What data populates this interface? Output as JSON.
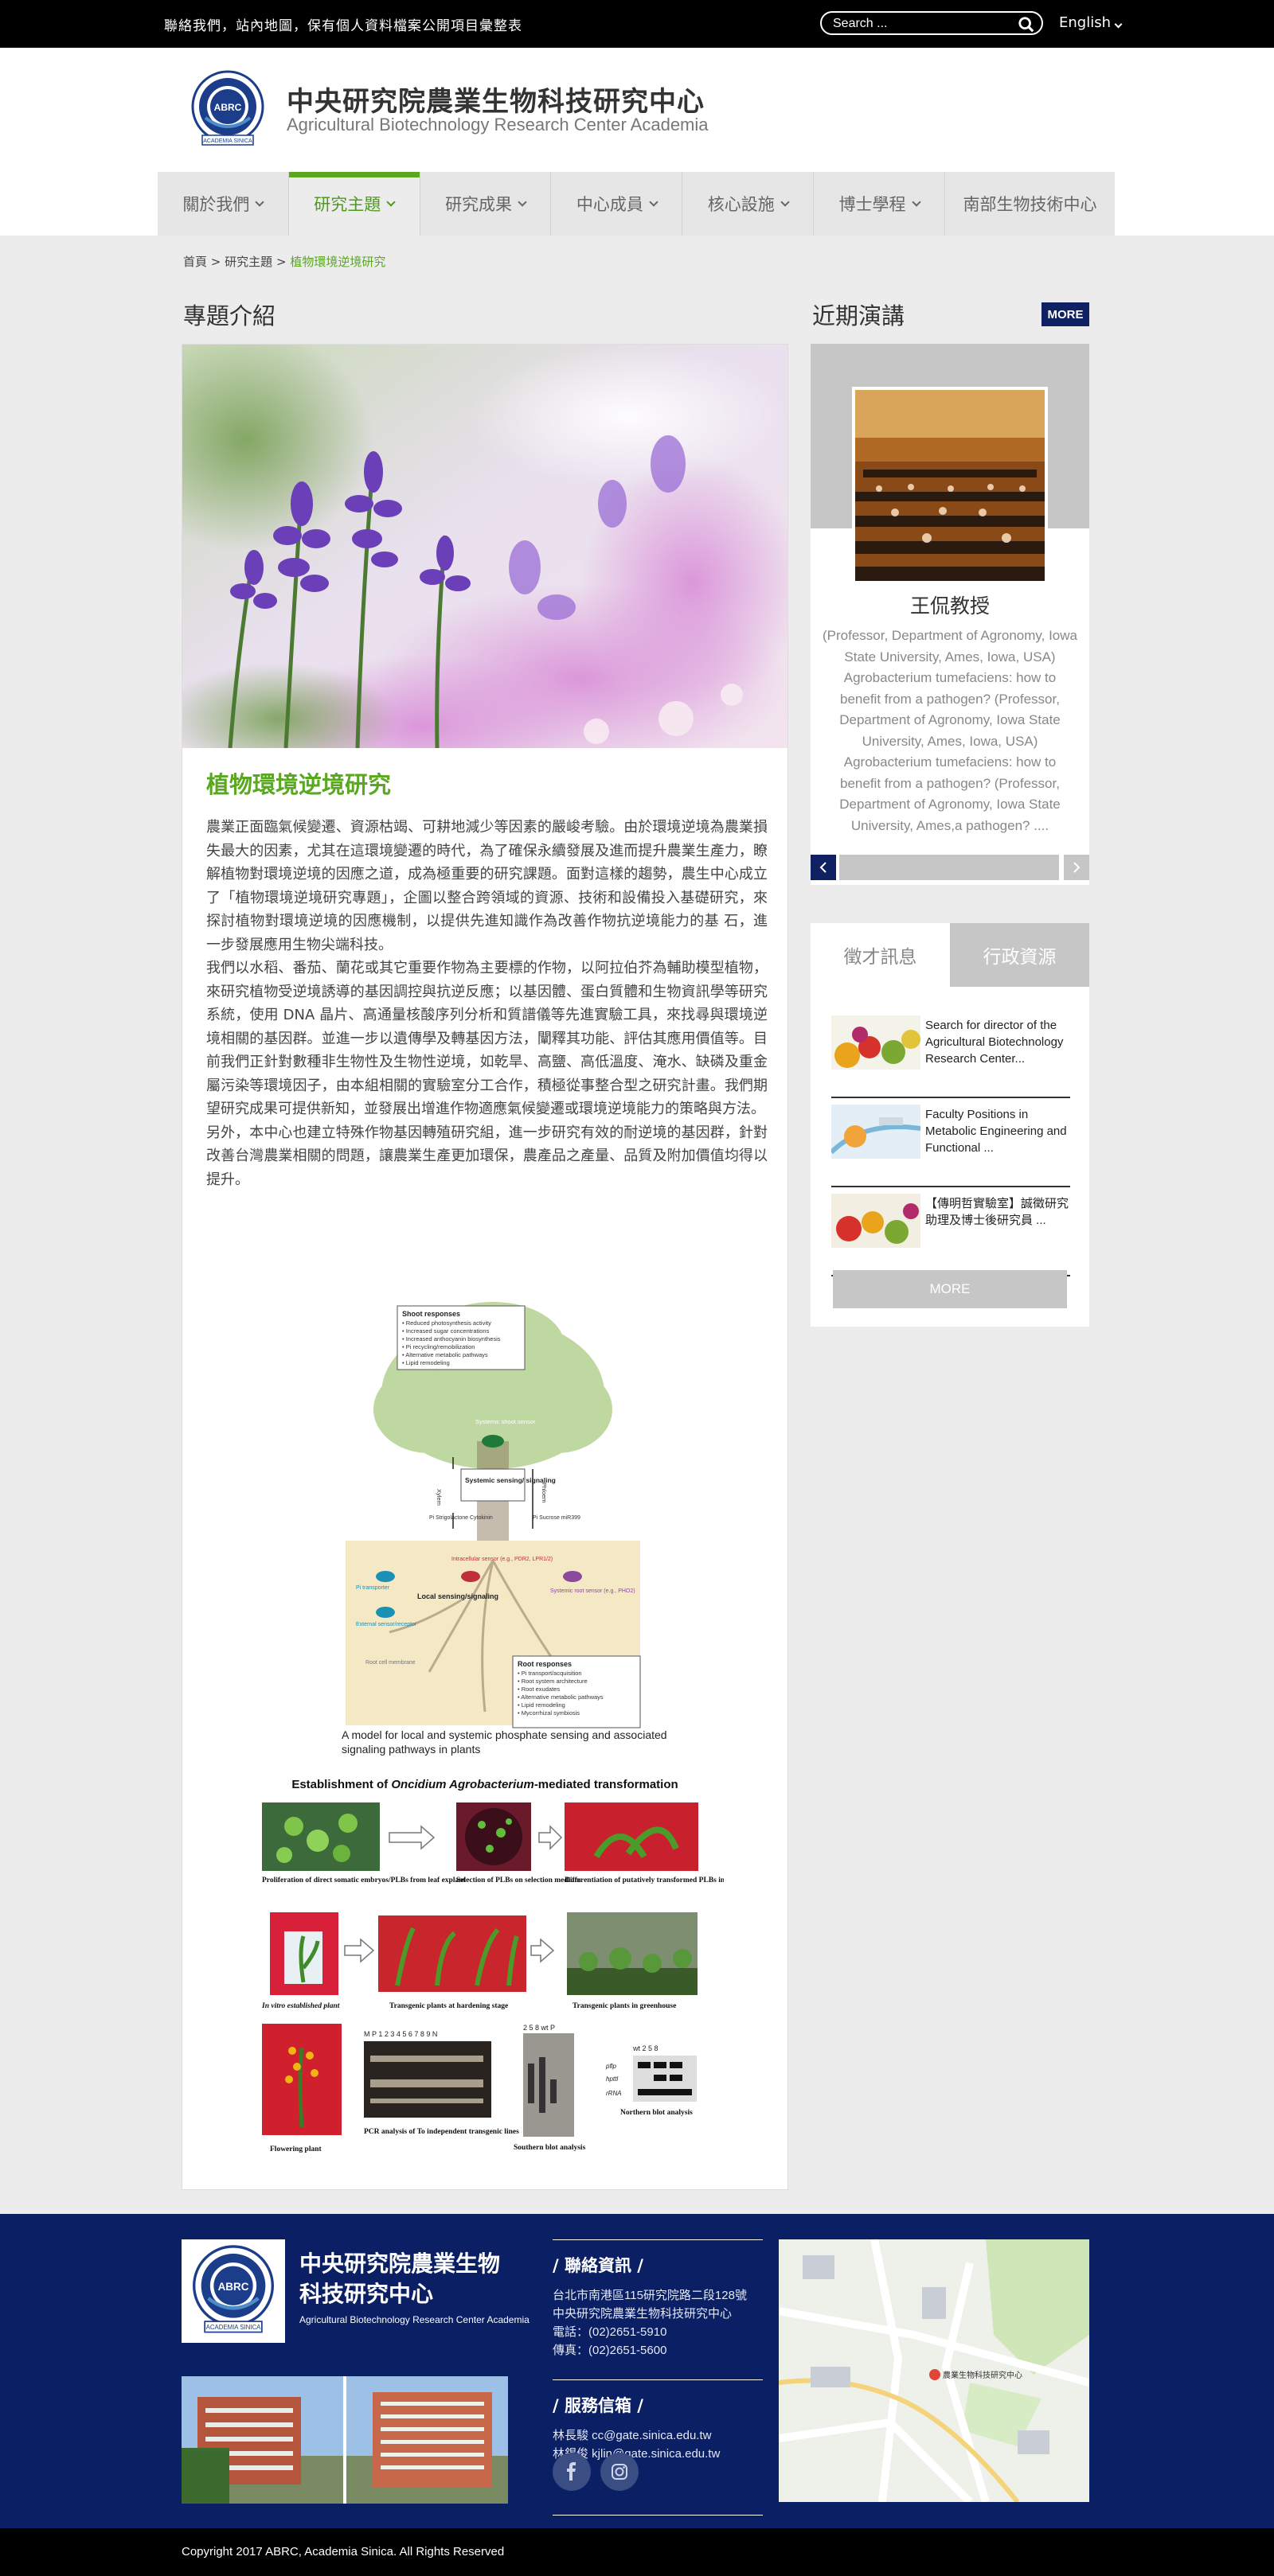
{
  "topbar": {
    "links": "聯絡我們，站內地圖，保有個人資料檔案公開項目彙整表",
    "search_placeholder": "Search ...",
    "language": "English"
  },
  "header": {
    "title": "中央研究院農業生物科技研究中心",
    "subtitle": "Agricultural Biotechnology Research Center Academia",
    "logo_text": "ABRC",
    "logo_caption": "ACADEMIA SINICA"
  },
  "nav": {
    "items": [
      {
        "label": "關於我們"
      },
      {
        "label": "研究主題"
      },
      {
        "label": "研究成果"
      },
      {
        "label": "中心成員"
      },
      {
        "label": "核心設施"
      },
      {
        "label": "博士學程"
      },
      {
        "label": "南部生物技術中心"
      }
    ]
  },
  "breadcrumb": {
    "home": "首頁",
    "sep": ">",
    "parent": "研究主題",
    "current": "植物環境逆境研究"
  },
  "main": {
    "section_title": "專題介紹",
    "topic_title": "植物環境逆境研究",
    "paragraphs": [
      "農業正面臨氣候變遷、資源枯竭、可耕地減少等因素的嚴峻考驗。由於環境逆境為農業損失最大的因素，尤其在這環境變遷的時代，為了確保永續發展及進而提升農業生產力，瞭解植物對環境逆境的因應之道，成為極重要的研究課題。面對這樣的趨勢，農生中心成立了「植物環境逆境研究專題」，企圖以整合跨領域的資源、技術和設備投入基礎研究，來探討植物對環境逆境的因應機制，以提供先進知識作為改善作物抗逆境能力的基 石，進一步發展應用生物尖端科技。",
      "我們以水稻、番茄、蘭花或其它重要作物為主要標的作物，以阿拉伯芥為輔助模型植物，來研究植物受逆境誘導的基因調控與抗逆反應；以基因體、蛋白質體和生物資訊學等研究系統，使用 DNA 晶片、高通量核酸序列分析和質譜儀等先進實驗工具，來找尋與環境逆境相關的基因群。並進一步以遺傳學及轉基因方法，闡釋其功能、評估其應用價值等。目前我們正針對數種非生物性及生物性逆境，如乾旱、高鹽、高低溫度、淹水、缺磷及重金屬污染等環境因子，由本組相關的實驗室分工合作，積極從事整合型之研究計畫。我們期望研究成果可提供新知，並發展出增進作物適應氣候變遷或環境逆境能力的策略與方法。",
      "另外，本中心也建立特殊作物基因轉殖研究組，進一步研究有效的耐逆境的基因群，針對改善台灣農業相關的問題，讓農業生產更加環保，農產品之產量、品質及附加價值均得以提升。"
    ],
    "figure1_caption": "A model for local and systemic phosphate sensing and associated signaling pathways in plants",
    "figure1": {
      "shoot_title": "Shoot responses",
      "shoot_items": [
        "• Reduced photosynthesis activity",
        "• Increased sugar concentrations",
        "• Increased anthocyanin biosynthesis",
        "• Pi recycling/remobilization",
        "• Alternative metabolic pathways",
        "• Lipid remodeling"
      ],
      "systemic_shoot": "Systemic shoot sensor",
      "systemic_signaling": "Systemic sensing/ signaling",
      "xylem": "Xylem",
      "phloem": "Phloem",
      "pi_left": "Pi Strigolactone Cytokinin",
      "pi_right": "Pi Sucrose miR399",
      "local": "Local sensing/signaling",
      "intracellular": "Intracellular sensor (e.g., PDR2, LPR1/2)",
      "pi_transporter": "Pi transporter",
      "external": "External sensor/receptor",
      "root_membrane": "Root cell membrane",
      "systemic_root": "Systemic root sensor (e.g., PHO2)",
      "root_title": "Root responses",
      "root_items": [
        "• Pi transport/acquisition",
        "• Root system architecture",
        "• Root exudates",
        "• Alternative metabolic pathways",
        "• Lipid remodeling",
        "• Mycorrhizal symbiosis"
      ]
    },
    "figure2": {
      "title_pre": "Establishment of ",
      "title_em": "Oncidium Agrobacterium",
      "title_post": "-mediated transformation",
      "captions": [
        "Proliferation of direct somatic embryos/PLBs from leaf explant",
        "Selection of PLBs on selection medium",
        "Differentiation of putatively transformed PLBs into plantlets",
        "In vitro established plant",
        "Transgenic plants at hardening stage",
        "Transgenic plants in greenhouse",
        "Flowering plant",
        "PCR analysis of To independent transgenic lines",
        "Southern blot analysis",
        "Northern blot analysis"
      ],
      "pcr_lanes": "M P 1 2 3 4 5 6 7 8 9 N",
      "southern_lanes": "2 5 8 wt P",
      "northern_lanes": "wt 2 5 8",
      "northern_rows": [
        "pflp",
        "hpttl",
        "rRNA"
      ]
    }
  },
  "sidebar": {
    "talks_title": "近期演講",
    "more_label": "MORE",
    "talk_name": "王侃教授",
    "talk_desc": "(Professor, Department of Agronomy, Iowa State University, Ames, Iowa, USA) Agrobacterium tumefaciens: how to benefit from a pathogen?  (Professor, Department of Agronomy, Iowa State University, Ames, Iowa, USA) Agrobacterium tumefaciens: how to benefit from a pathogen?  (Professor, Department of Agronomy, Iowa State University, Ames,a pathogen? ....",
    "tabs": [
      "徵才訊息",
      "行政資源"
    ],
    "news": [
      "Search for director of the Agricultural Biotechnology Research Center...",
      "Faculty Positions in Metabolic Engineering and Functional  ...",
      "【傳明哲實驗室】誠徵研究助理及博士後研究員 ..."
    ],
    "news_more": "MORE"
  },
  "footer": {
    "title_line1": "中央研究院農業生物",
    "title_line2": "科技研究中心",
    "subtitle": "Agricultural Biotechnology Research Center Academia",
    "contact_title": "/ 聯絡資訊 /",
    "address1": "台北市南港區115研究院路二段128號",
    "address2": "中央研究院農業生物科技研究中心",
    "phone": "電話：(02)2651-5910",
    "fax": "傳真：(02)2651-5600",
    "mail_title": "/ 服務信箱 /",
    "mail1": "林長駿  cc@gate.sinica.edu.tw",
    "mail2": "林錫俊  kjlin@gate.sinica.edu.tw",
    "map_label": "農業生物科技研究中心"
  },
  "copyright": "Copyright 2017 ABRC, Academia Sinica. All Rights Reserved",
  "colors": {
    "accent_green": "#59a820",
    "navy": "#0a1f64",
    "sidebar_gray": "#c6c6c6"
  },
  "icons": [
    "search-icon",
    "chevron-down-icon",
    "facebook-icon",
    "instagram-icon",
    "arrow-left-icon",
    "arrow-right-icon"
  ]
}
